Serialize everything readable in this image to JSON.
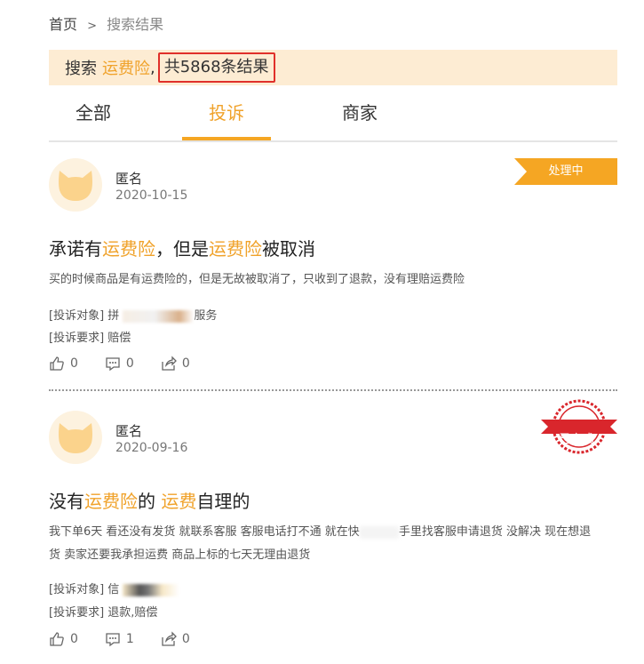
{
  "breadcrumb": {
    "home": "首页",
    "separator": ">",
    "current": "搜索结果"
  },
  "summary": {
    "prefix": "搜索",
    "keyword": "运费险",
    "comma": ",",
    "count_text": "共5868条结果"
  },
  "tabs": [
    {
      "label": "全部"
    },
    {
      "label": "投诉"
    },
    {
      "label": "商家"
    }
  ],
  "active_tab": "投诉",
  "colors": {
    "accent": "#f5a623",
    "highlight_text": "#f0a22a",
    "stamp_red": "#d9262c",
    "summary_bg": "#fdecd3"
  },
  "results": [
    {
      "user": "匿名",
      "date": "2020-10-15",
      "status": "处理中",
      "title": {
        "t1": "承诺有",
        "h1": "运费险",
        "t2": "，但是",
        "h2": "运费险",
        "t3": "被取消"
      },
      "body_line1": "买的时候商品是有运费险的，但是无故被取消了，只收到了退款，没有理赔运费险",
      "object_label": "[投诉对象]",
      "object_value_start": "拼",
      "object_value_end": "服务",
      "request_label": "[投诉要求]",
      "request_value": "赔偿",
      "likes": "0",
      "comments": "0",
      "shares": "0"
    },
    {
      "user": "匿名",
      "date": "2020-09-16",
      "status": "已完成",
      "title": {
        "t1": "没有",
        "h1": "运费险",
        "t2": "的 ",
        "h2": "运费",
        "t3": "自理的"
      },
      "body_line1a": "我下单6天 看还没有发货 就联系客服 客服电话打不通 就在快",
      "body_line1b": "手里找客服申请退货 没解决 现在想退",
      "body_line2": "货 卖家还要我承担运费 商品上标的七天无理由退货",
      "object_label": "[投诉对象]",
      "object_value_start": "信",
      "request_label": "[投诉要求]",
      "request_value": "退款,赔偿",
      "likes": "0",
      "comments": "1",
      "shares": "0"
    }
  ],
  "icons": [
    "cat-avatar-icon",
    "thumbs-up-icon",
    "comment-icon",
    "share-icon"
  ]
}
